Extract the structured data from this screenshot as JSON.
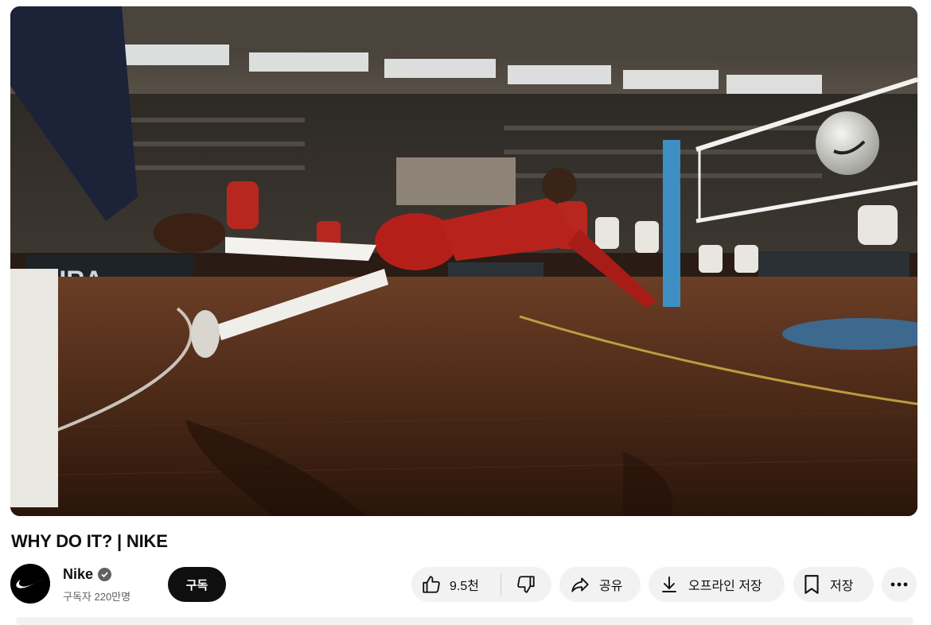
{
  "video": {
    "title": "WHY DO IT? | NIKE",
    "thumbnail_description": "volleyball-player-diving-scene"
  },
  "channel": {
    "name": "Nike",
    "verified": true,
    "subscribers": "구독자 220만명",
    "avatar_icon": "nike-swoosh-icon",
    "subscribe_label": "구독"
  },
  "actions": {
    "like_count": "9.5천",
    "like_icon": "thumbs-up-icon",
    "dislike_icon": "thumbs-down-icon",
    "share_label": "공유",
    "share_icon": "share-arrow-icon",
    "download_label": "오프라인 저장",
    "download_icon": "download-icon",
    "save_label": "저장",
    "save_icon": "bookmark-icon",
    "more_icon": "more-horizontal-icon"
  },
  "colors": {
    "subscribe_bg": "#0f0f0f",
    "pill_bg": "#f2f2f2",
    "secondary_text": "#606060"
  }
}
